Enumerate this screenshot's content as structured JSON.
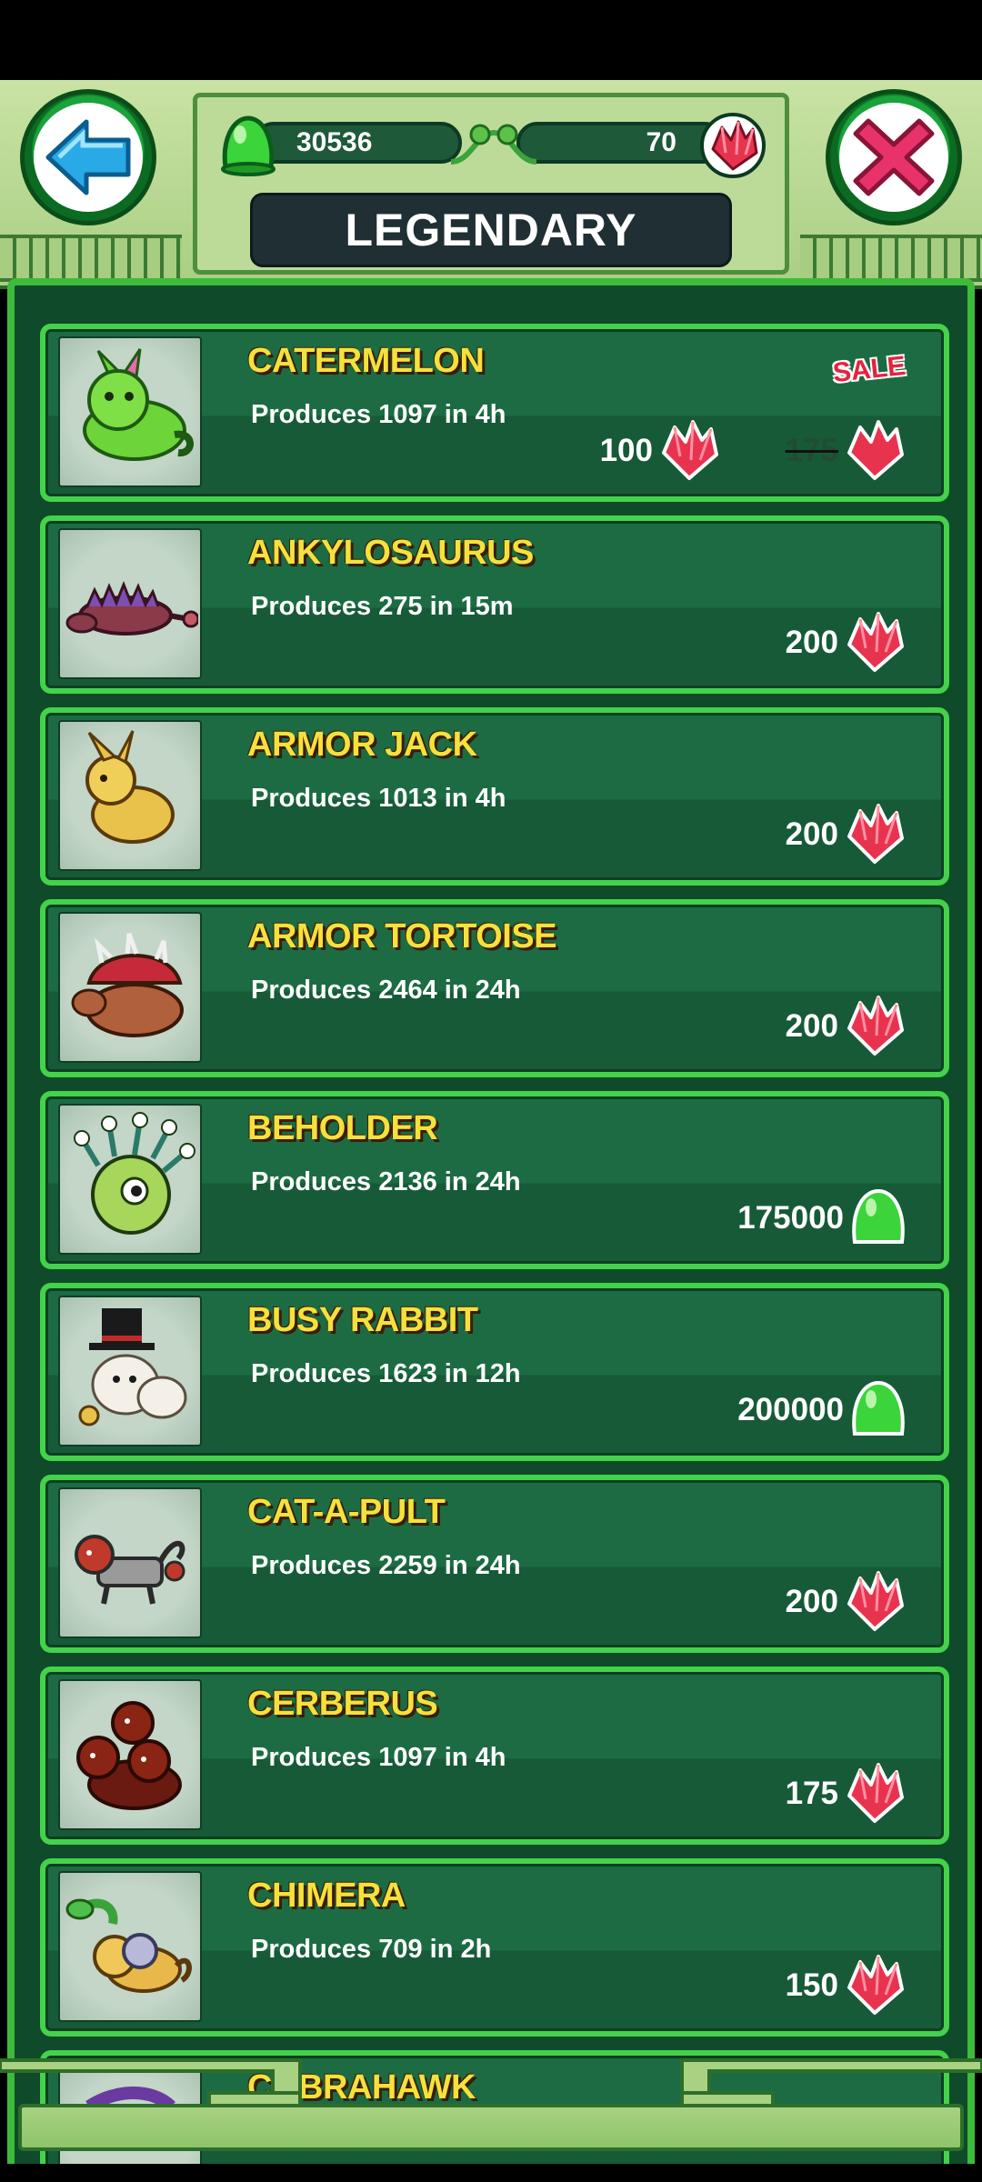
{
  "header": {
    "title": "LEGENDARY",
    "jelly_count": "30536",
    "gem_count": "70"
  },
  "colors": {
    "gem": "#e8334f",
    "jelly": "#3bd43b",
    "name_text": "#f5e13c",
    "card_border": "#43d24a"
  },
  "icons": {
    "back": "back-arrow-icon",
    "close": "close-x-icon",
    "gem": "gem-icon",
    "jelly": "jelly-icon"
  },
  "items": [
    {
      "name": "CATERMELON",
      "produces": "Produces 1097 in 4h",
      "price": "100",
      "currency": "gem",
      "sale": true,
      "sale_label": "SALE",
      "old_price": "175"
    },
    {
      "name": "ANKYLOSAURUS",
      "produces": "Produces 275 in 15m",
      "price": "200",
      "currency": "gem"
    },
    {
      "name": "ARMOR JACK",
      "produces": "Produces 1013 in 4h",
      "price": "200",
      "currency": "gem"
    },
    {
      "name": "ARMOR TORTOISE",
      "produces": "Produces 2464 in 24h",
      "price": "200",
      "currency": "gem"
    },
    {
      "name": "BEHOLDER",
      "produces": "Produces 2136 in 24h",
      "price": "175000",
      "currency": "jelly"
    },
    {
      "name": "BUSY RABBIT",
      "produces": "Produces 1623 in 12h",
      "price": "200000",
      "currency": "jelly"
    },
    {
      "name": "CAT-A-PULT",
      "produces": "Produces 2259 in 24h",
      "price": "200",
      "currency": "gem"
    },
    {
      "name": "CERBERUS",
      "produces": "Produces 1097 in 4h",
      "price": "175",
      "currency": "gem"
    },
    {
      "name": "CHIMERA",
      "produces": "Produces 709 in 2h",
      "price": "150",
      "currency": "gem"
    },
    {
      "name": "COBRAHAWK",
      "produces": "",
      "price": "",
      "currency": "gem"
    }
  ]
}
